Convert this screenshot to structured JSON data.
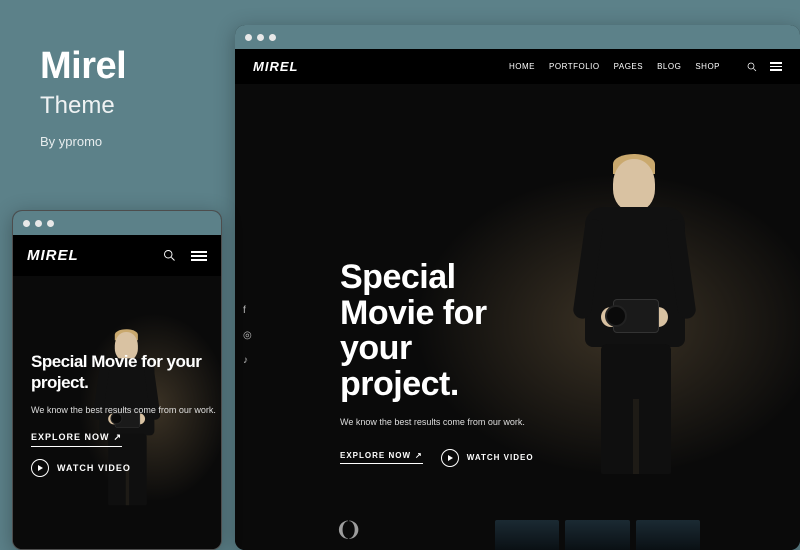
{
  "theme": {
    "title": "Mirel",
    "subtitle": "Theme",
    "byline": "By ypromo"
  },
  "site": {
    "logo": "MIREL",
    "nav": [
      "HOME",
      "PORTFOLIO",
      "PAGES",
      "BLOG",
      "SHOP"
    ],
    "hero": {
      "title_line1": "Special",
      "title_line2": "Movie for",
      "title_line3": "your",
      "title_line4": "project.",
      "title_mobile": "Special Movie for your project.",
      "subtitle": "We know the best results come from our work.",
      "explore": "EXPLORE NOW",
      "explore_arrow": "↗",
      "watch": "WATCH VIDEO"
    },
    "social": [
      "f",
      "◎",
      "♪"
    ]
  }
}
